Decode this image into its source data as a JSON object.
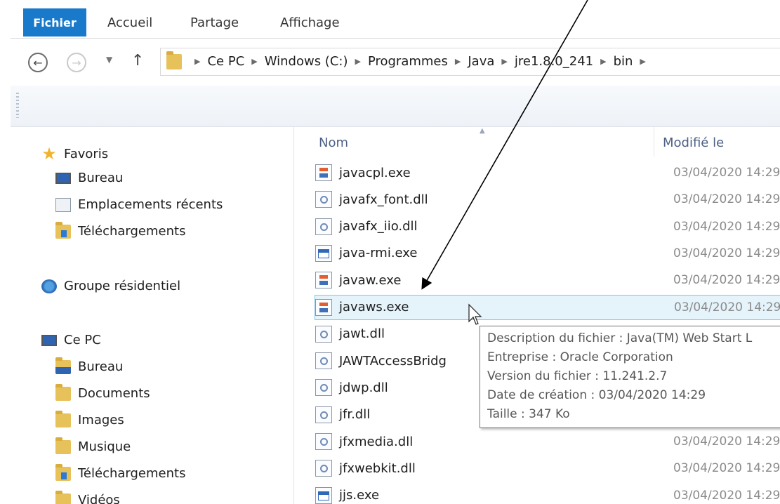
{
  "ribbon": {
    "file_tab": "Fichier",
    "tabs": [
      "Accueil",
      "Partage",
      "Affichage"
    ]
  },
  "address": {
    "crumbs": [
      "Ce PC",
      "Windows (C:)",
      "Programmes",
      "Java",
      "jre1.8.0_241",
      "bin"
    ]
  },
  "nav": {
    "favorites_label": "Favoris",
    "favorites": [
      "Bureau",
      "Emplacements récents",
      "Téléchargements"
    ],
    "homegroup": "Groupe résidentiel",
    "this_pc": "Ce PC",
    "pc_items": [
      "Bureau",
      "Documents",
      "Images",
      "Musique",
      "Téléchargements",
      "Vidéos"
    ]
  },
  "columns": {
    "name": "Nom",
    "modified": "Modifié le"
  },
  "files": [
    {
      "name": "javacpl.exe",
      "icon": "java-icon",
      "date": "03/04/2020 14:29"
    },
    {
      "name": "javafx_font.dll",
      "icon": "dll-icon",
      "date": "03/04/2020 14:29"
    },
    {
      "name": "javafx_iio.dll",
      "icon": "dll-icon",
      "date": "03/04/2020 14:29"
    },
    {
      "name": "java-rmi.exe",
      "icon": "app-icon",
      "date": "03/04/2020 14:29"
    },
    {
      "name": "javaw.exe",
      "icon": "java-icon",
      "date": "03/04/2020 14:29"
    },
    {
      "name": "javaws.exe",
      "icon": "java-icon",
      "date": "03/04/2020 14:29"
    },
    {
      "name": "jawt.dll",
      "icon": "dll-icon",
      "date": ""
    },
    {
      "name": "JAWTAccessBridg",
      "icon": "dll-icon",
      "date": ""
    },
    {
      "name": "jdwp.dll",
      "icon": "dll-icon",
      "date": ""
    },
    {
      "name": "jfr.dll",
      "icon": "dll-icon",
      "date": ""
    },
    {
      "name": "jfxmedia.dll",
      "icon": "dll-icon",
      "date": "03/04/2020 14:29"
    },
    {
      "name": "jfxwebkit.dll",
      "icon": "dll-icon",
      "date": "03/04/2020 14:29"
    },
    {
      "name": "jjs.exe",
      "icon": "app-icon",
      "date": "03/04/2020 14:29"
    }
  ],
  "tooltip": {
    "lines": [
      "Description du fichier : Java(TM) Web Start L",
      "Entreprise : Oracle Corporation",
      "Version du fichier : 11.241.2.7",
      "Date de création : 03/04/2020 14:29",
      "Taille : 347 Ko"
    ]
  },
  "colors": {
    "accent": "#1979ca",
    "selection": "#e5f3fb",
    "selection_border": "#84c4e9"
  }
}
